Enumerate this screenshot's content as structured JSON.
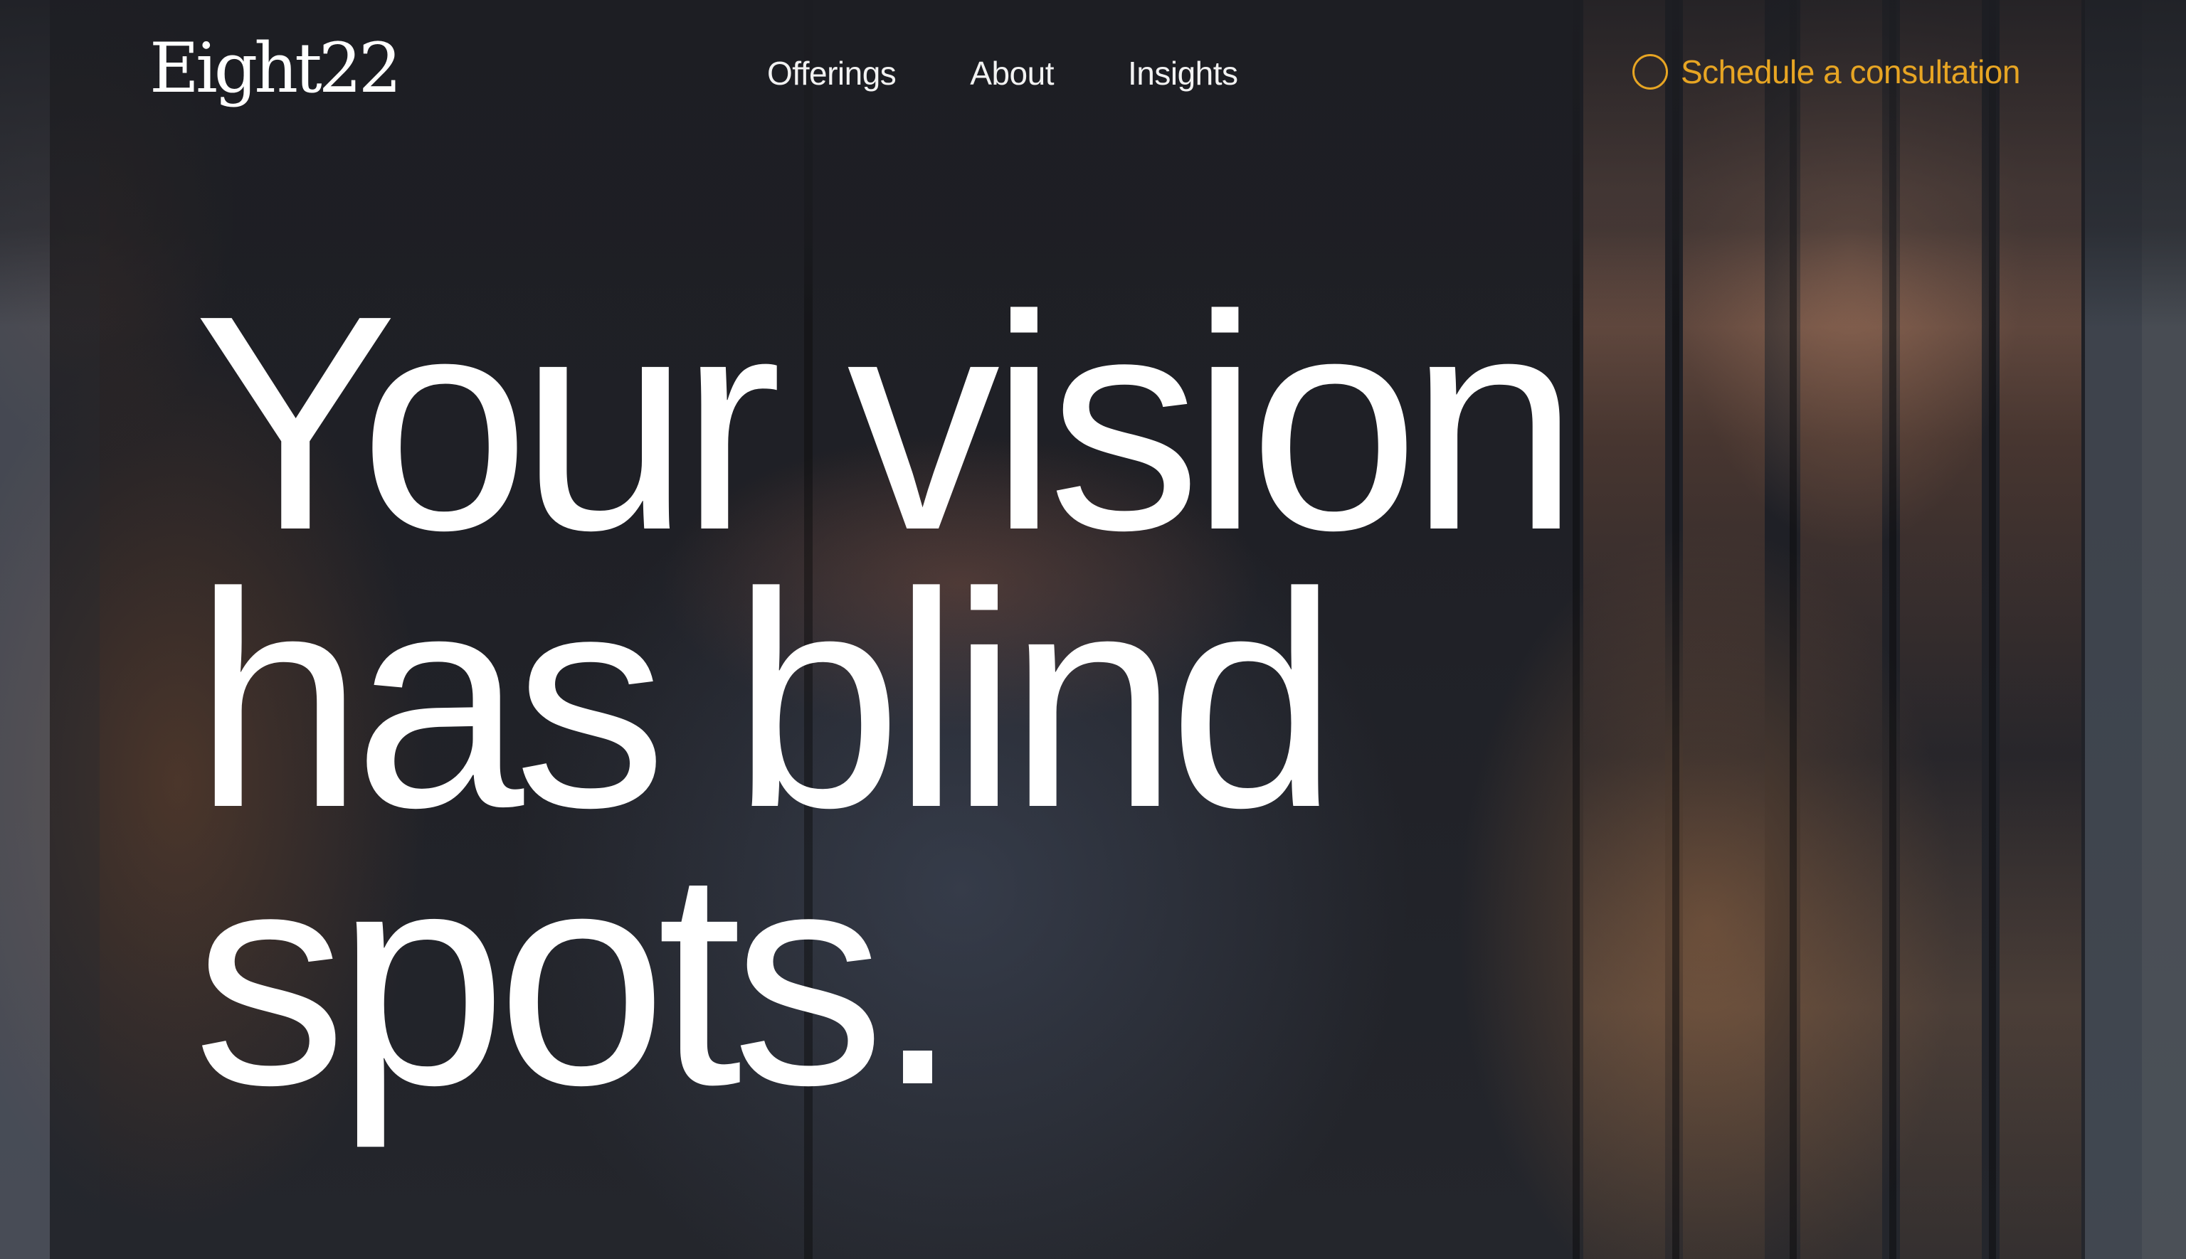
{
  "header": {
    "logo": "Eight22",
    "nav": [
      {
        "label": "Offerings"
      },
      {
        "label": "About"
      },
      {
        "label": "Insights"
      }
    ],
    "cta": {
      "label": "Schedule a consultation",
      "icon": "circle-icon",
      "color": "#e7a523"
    }
  },
  "hero": {
    "headline_lines": [
      "Your vision",
      "has blind",
      "spots."
    ],
    "background": "sliced-portrait-photo"
  },
  "colors": {
    "background": "#1d1e23",
    "text": "#ffffff",
    "accent": "#e7a523"
  }
}
